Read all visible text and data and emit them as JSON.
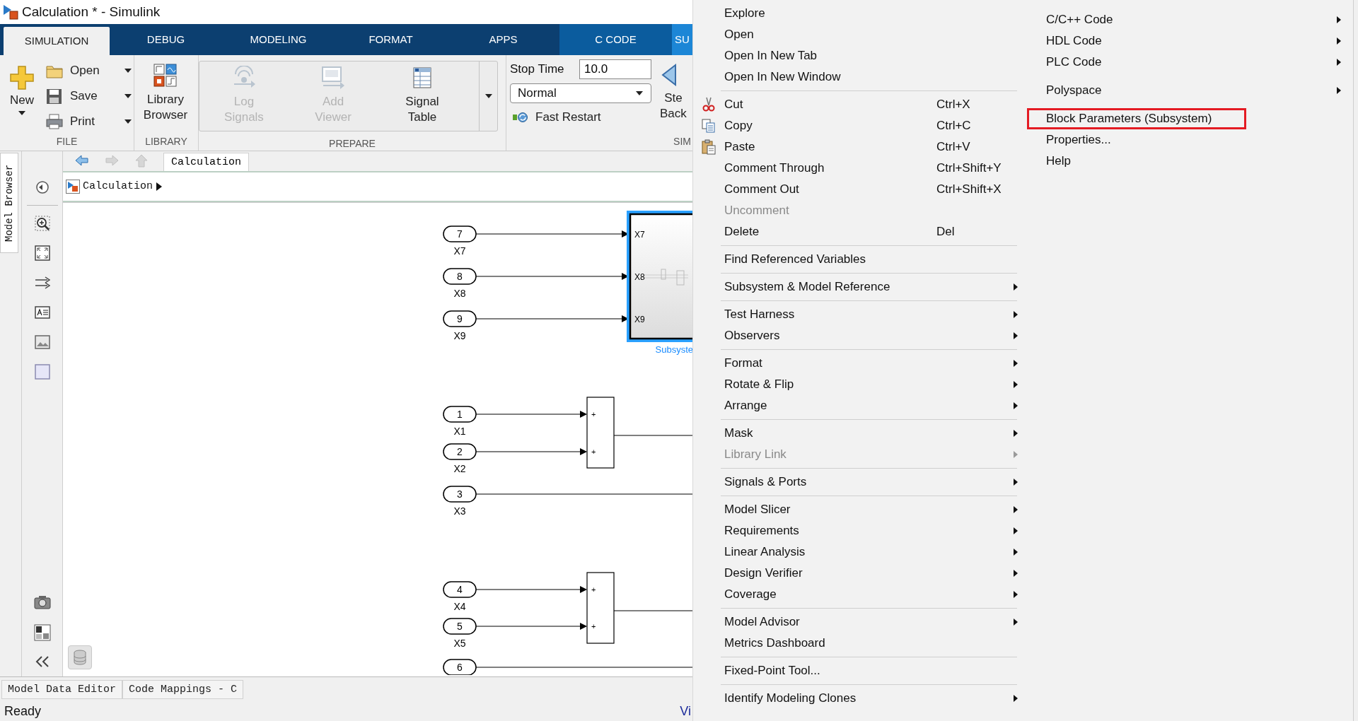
{
  "window": {
    "title": "Calculation * - Simulink"
  },
  "ribbon_tabs": [
    {
      "label": "SIMULATION",
      "selected": true,
      "kind": "standard"
    },
    {
      "label": "DEBUG",
      "selected": false,
      "kind": "standard"
    },
    {
      "label": "MODELING",
      "selected": false,
      "kind": "standard"
    },
    {
      "label": "FORMAT",
      "selected": false,
      "kind": "standard"
    },
    {
      "label": "APPS",
      "selected": false,
      "kind": "standard"
    },
    {
      "label": "C CODE",
      "selected": false,
      "kind": "app"
    },
    {
      "label": "SU",
      "selected": false,
      "kind": "contextual"
    }
  ],
  "file_section": {
    "label": "FILE",
    "new_button": {
      "label": "New"
    },
    "items": [
      {
        "label": "Open"
      },
      {
        "label": "Save"
      },
      {
        "label": "Print"
      }
    ]
  },
  "library_section": {
    "label": "LIBRARY",
    "button": {
      "lines": [
        "Library",
        "Browser"
      ]
    }
  },
  "prepare_section": {
    "label": "PREPARE",
    "buttons": [
      {
        "lines": [
          "Log",
          "Signals"
        ],
        "disabled": true
      },
      {
        "lines": [
          "Add",
          "Viewer"
        ],
        "disabled": true
      },
      {
        "lines": [
          "Signal",
          "Table"
        ],
        "disabled": false
      }
    ]
  },
  "simulate_section": {
    "label": "SIM",
    "stop_time": {
      "label": "Stop Time",
      "value": "10.0"
    },
    "mode": {
      "value": "Normal"
    },
    "fast_restart": {
      "label": "Fast Restart"
    },
    "step_back": {
      "lines": [
        "Ste",
        "Back"
      ]
    }
  },
  "side_tab": {
    "label": "Model Browser"
  },
  "nav_buttons": [
    {
      "disabled": false
    },
    {
      "disabled": true
    },
    {
      "disabled": true
    }
  ],
  "model_tab": {
    "label": "Calculation"
  },
  "address_bar": {
    "path": "Calculation"
  },
  "diagram": {
    "inports": [
      {
        "number": "7",
        "label": "X7"
      },
      {
        "number": "8",
        "label": "X8"
      },
      {
        "number": "9",
        "label": "X9"
      },
      {
        "number": "1",
        "label": "X1"
      },
      {
        "number": "2",
        "label": "X2"
      },
      {
        "number": "3",
        "label": "X3"
      },
      {
        "number": "4",
        "label": "X4"
      },
      {
        "number": "5",
        "label": "X5"
      },
      {
        "number": "6"
      }
    ],
    "subsystem": {
      "name": "Subsyste",
      "selected": true,
      "ports": [
        "X7",
        "X8",
        "X9"
      ]
    },
    "sum_blocks": [
      {
        "signs": [
          "+",
          "+"
        ]
      },
      {
        "signs": [
          "+",
          "+"
        ]
      }
    ]
  },
  "bottom_tabs": [
    {
      "label": "Model Data Editor"
    },
    {
      "label": "Code Mappings - C"
    }
  ],
  "status_bar": {
    "text": "Ready",
    "right_text": "Vi"
  },
  "context_menu": {
    "columns": [
      {
        "groups": [
          [
            {
              "label": "Explore",
              "submenu": false,
              "disabled": false
            },
            {
              "label": "Open",
              "submenu": false,
              "disabled": false
            },
            {
              "label": "Open In New Tab",
              "submenu": false,
              "disabled": false
            },
            {
              "label": "Open In New Window",
              "submenu": false,
              "disabled": false
            }
          ],
          [
            {
              "label": "Cut",
              "shortcut": "Ctrl+X",
              "submenu": false,
              "disabled": false
            },
            {
              "label": "Copy",
              "shortcut": "Ctrl+C",
              "submenu": false,
              "disabled": false
            },
            {
              "label": "Paste",
              "shortcut": "Ctrl+V",
              "submenu": false,
              "disabled": false
            },
            {
              "label": "Comment Through",
              "shortcut": "Ctrl+Shift+Y",
              "submenu": false,
              "disabled": false
            },
            {
              "label": "Comment Out",
              "shortcut": "Ctrl+Shift+X",
              "submenu": false,
              "disabled": false
            },
            {
              "label": "Uncomment",
              "submenu": false,
              "disabled": true
            },
            {
              "label": "Delete",
              "shortcut": "Del",
              "submenu": false,
              "disabled": false
            }
          ],
          [
            {
              "label": "Find Referenced Variables",
              "submenu": false,
              "disabled": false
            }
          ],
          [
            {
              "label": "Subsystem & Model Reference",
              "submenu": true,
              "disabled": false
            }
          ],
          [
            {
              "label": "Test Harness",
              "submenu": true,
              "disabled": false
            },
            {
              "label": "Observers",
              "submenu": true,
              "disabled": false
            }
          ],
          [
            {
              "label": "Format",
              "submenu": true,
              "disabled": false
            },
            {
              "label": "Rotate & Flip",
              "submenu": true,
              "disabled": false
            },
            {
              "label": "Arrange",
              "submenu": true,
              "disabled": false
            }
          ],
          [
            {
              "label": "Mask",
              "submenu": true,
              "disabled": false
            },
            {
              "label": "Library Link",
              "submenu": true,
              "disabled": true
            }
          ],
          [
            {
              "label": "Signals & Ports",
              "submenu": true,
              "disabled": false
            }
          ],
          [
            {
              "label": "Model Slicer",
              "submenu": true,
              "disabled": false
            },
            {
              "label": "Requirements",
              "submenu": true,
              "disabled": false
            },
            {
              "label": "Linear Analysis",
              "submenu": true,
              "disabled": false
            },
            {
              "label": "Design Verifier",
              "submenu": true,
              "disabled": false
            },
            {
              "label": "Coverage",
              "submenu": true,
              "disabled": false
            }
          ],
          [
            {
              "label": "Model Advisor",
              "submenu": true,
              "disabled": false
            },
            {
              "label": "Metrics Dashboard",
              "submenu": false,
              "disabled": false
            }
          ],
          [
            {
              "label": "Fixed-Point Tool...",
              "submenu": false,
              "disabled": false
            }
          ],
          [
            {
              "label": "Identify Modeling Clones",
              "submenu": true,
              "disabled": false
            }
          ]
        ]
      },
      {
        "groups": [
          [
            {
              "label": "C/C++ Code",
              "submenu": true,
              "highlighted": false
            },
            {
              "label": "HDL Code",
              "submenu": true,
              "highlighted": false
            },
            {
              "label": "PLC Code",
              "submenu": true,
              "highlighted": false
            }
          ],
          [
            {
              "label": "Polyspace",
              "submenu": true,
              "highlighted": false
            }
          ],
          [
            {
              "label": "Block Parameters (Subsystem)",
              "submenu": false,
              "highlighted": true
            },
            {
              "label": "Properties...",
              "submenu": false,
              "highlighted": false
            },
            {
              "label": "Help",
              "submenu": false,
              "highlighted": false
            }
          ]
        ]
      }
    ]
  }
}
